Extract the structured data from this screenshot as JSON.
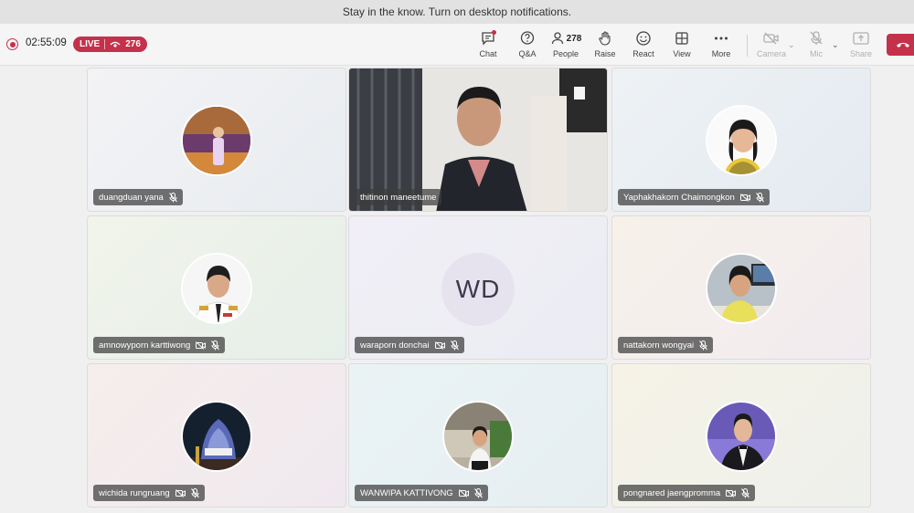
{
  "notification": {
    "text": "Stay in the know. Turn on desktop notifications."
  },
  "meeting": {
    "timer": "02:55:09",
    "live_label": "LIVE",
    "viewer_count": "276"
  },
  "toolbar": {
    "chat": "Chat",
    "qa": "Q&A",
    "people": "People",
    "people_count": "278",
    "raise": "Raise",
    "react": "React",
    "view": "View",
    "more": "More",
    "camera": "Camera",
    "mic": "Mic",
    "share": "Share"
  },
  "participants": [
    {
      "name": "duangduan yana",
      "icons": [
        "mic-off-icon"
      ]
    },
    {
      "name": "thitinon maneetume",
      "icons": []
    },
    {
      "name": "Yaphakhakorn Chaimongkon",
      "icons": [
        "video-off-icon",
        "mic-off-icon"
      ]
    },
    {
      "name": "amnowyporn karttiwong",
      "icons": [
        "video-off-icon",
        "mic-off-icon"
      ]
    },
    {
      "name": "waraporn donchai",
      "initials": "WD",
      "icons": [
        "video-off-icon",
        "mic-off-icon"
      ]
    },
    {
      "name": "nattakorn wongyai",
      "icons": [
        "mic-off-icon"
      ]
    },
    {
      "name": "wichida rungruang",
      "icons": [
        "video-off-icon",
        "mic-off-icon"
      ]
    },
    {
      "name": "WANWIPA KATTIVONG",
      "icons": [
        "video-off-icon",
        "mic-off-icon"
      ]
    },
    {
      "name": "pongnared jaengpromma",
      "icons": [
        "video-off-icon",
        "mic-off-icon"
      ]
    }
  ],
  "colors": {
    "live_red": "#c4314b",
    "leave_red": "#c4314b"
  }
}
